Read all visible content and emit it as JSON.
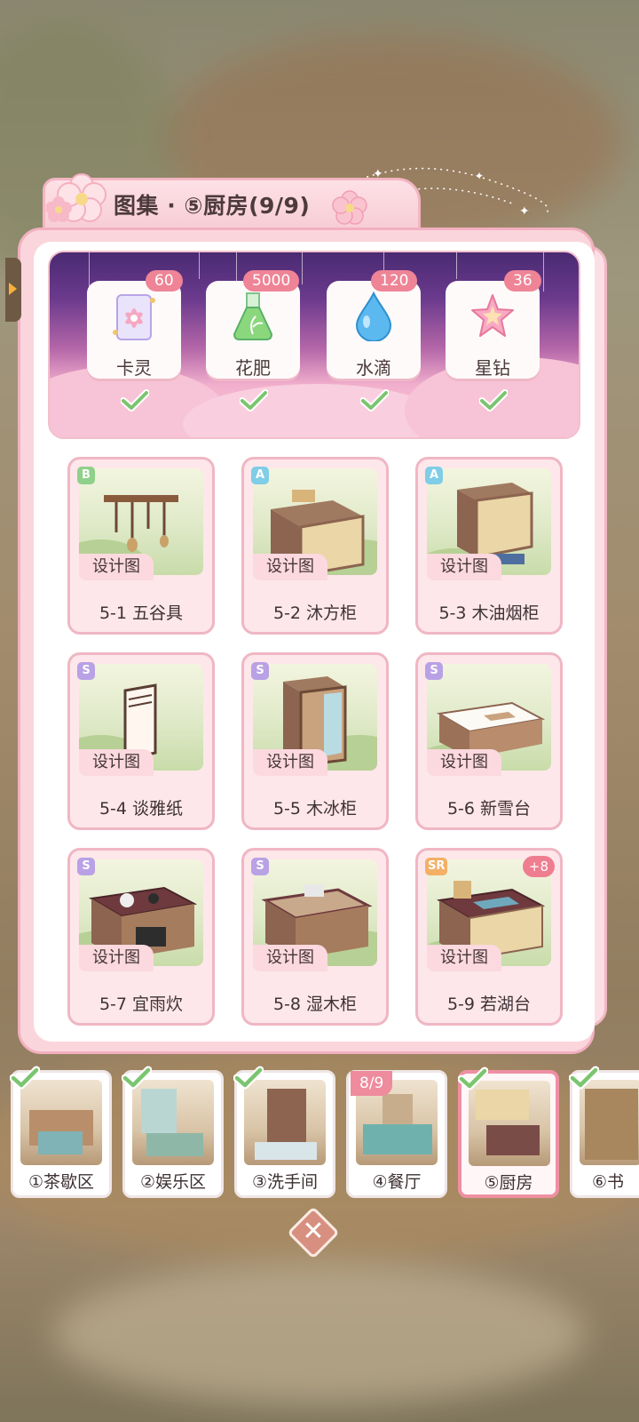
{
  "header": {
    "title": "图集 · ⑤厨房(9/9)"
  },
  "rewards": [
    {
      "label": "卡灵",
      "count": "60",
      "icon": "card-spirit-icon",
      "claimed": true
    },
    {
      "label": "花肥",
      "count": "5000",
      "icon": "fertilizer-flask-icon",
      "claimed": true
    },
    {
      "label": "水滴",
      "count": "120",
      "icon": "water-drop-icon",
      "claimed": true
    },
    {
      "label": "星钻",
      "count": "36",
      "icon": "star-diamond-icon",
      "claimed": true
    }
  ],
  "items": [
    {
      "rarity": "B",
      "tag": "设计图",
      "name": "5-1 五谷具",
      "extra": ""
    },
    {
      "rarity": "A",
      "tag": "设计图",
      "name": "5-2 沐方柜",
      "extra": ""
    },
    {
      "rarity": "A",
      "tag": "设计图",
      "name": "5-3 木油烟柜",
      "extra": ""
    },
    {
      "rarity": "S",
      "tag": "设计图",
      "name": "5-4 谈雅纸",
      "extra": ""
    },
    {
      "rarity": "S",
      "tag": "设计图",
      "name": "5-5 木冰柜",
      "extra": ""
    },
    {
      "rarity": "S",
      "tag": "设计图",
      "name": "5-6 新雪台",
      "extra": ""
    },
    {
      "rarity": "S",
      "tag": "设计图",
      "name": "5-7 宜雨炊",
      "extra": ""
    },
    {
      "rarity": "S",
      "tag": "设计图",
      "name": "5-8 湿木柜",
      "extra": ""
    },
    {
      "rarity": "SR",
      "tag": "设计图",
      "name": "5-9 若湖台",
      "extra": "+8"
    }
  ],
  "rooms": [
    {
      "label": "①茶歇区",
      "progress": "",
      "complete": true,
      "selected": false
    },
    {
      "label": "②娱乐区",
      "progress": "",
      "complete": true,
      "selected": false
    },
    {
      "label": "③洗手间",
      "progress": "",
      "complete": true,
      "selected": false
    },
    {
      "label": "④餐厅",
      "progress": "8/9",
      "complete": false,
      "selected": false
    },
    {
      "label": "⑤厨房",
      "progress": "",
      "complete": true,
      "selected": true
    },
    {
      "label": "⑥书",
      "progress": "",
      "complete": true,
      "selected": false
    }
  ],
  "colors": {
    "card_border": "#f2b0bf",
    "accent_pink": "#ee8496",
    "rarity_B": "#8fd08a",
    "rarity_A": "#7fcde6",
    "rarity_S": "#b9a1e6",
    "rarity_SR": "#f3b066"
  },
  "close_icon": "close-icon"
}
